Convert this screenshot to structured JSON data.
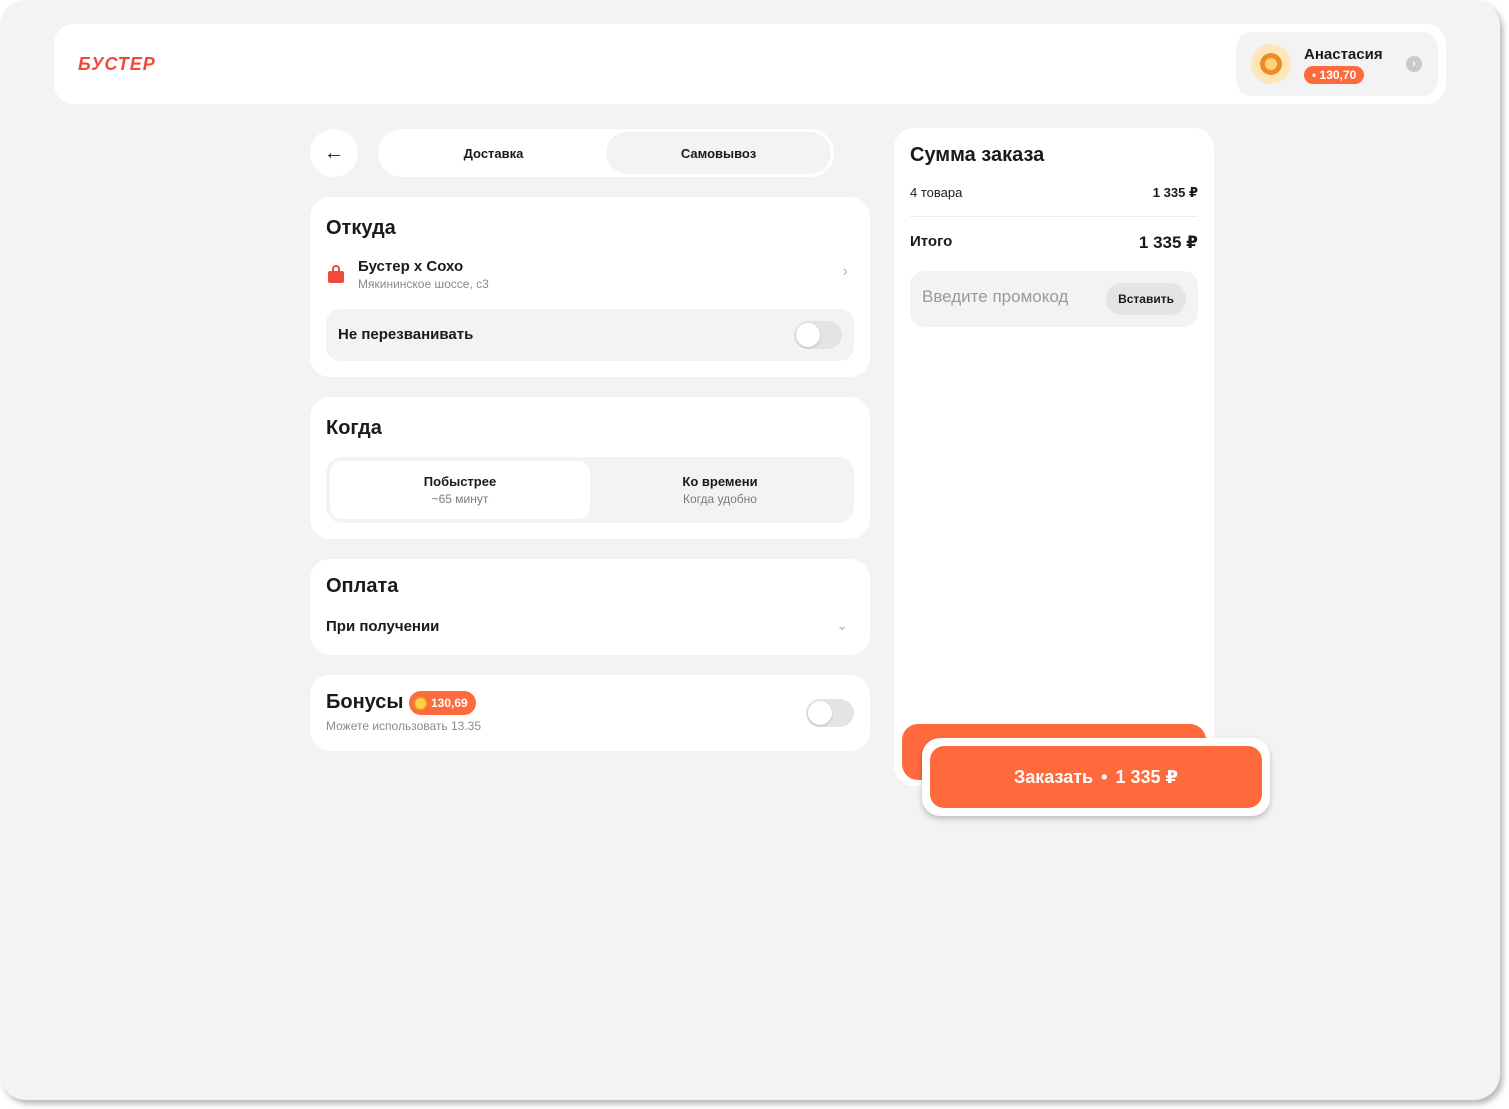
{
  "header": {
    "logo": "БУСТЕР",
    "user": {
      "name": "Анастасия",
      "balance": "• 130,70"
    }
  },
  "delivery_tabs": [
    {
      "label": "Доставка",
      "active": false
    },
    {
      "label": "Самовывоз",
      "active": true
    }
  ],
  "from": {
    "title": "Откуда",
    "store_name": "Бустер х Сохо",
    "store_address": "Мякининское шоссе, с3",
    "no_call_label": "Не перезванивать",
    "no_call_enabled": false
  },
  "when": {
    "title": "Когда",
    "options": [
      {
        "title": "Побыстрее",
        "subtitle": "~65 минут",
        "active": true
      },
      {
        "title": "Ко времени",
        "subtitle": "Когда удобно",
        "active": false
      }
    ]
  },
  "payment": {
    "title": "Оплата",
    "selected": "При получении"
  },
  "bonuses": {
    "title": "Бонусы",
    "badge": "130,69",
    "subtitle": "Можете использовать 13.35",
    "enabled": false
  },
  "summary": {
    "title": "Сумма заказа",
    "items_label": "4 товара",
    "items_value": "1 335 ₽",
    "total_label": "Итого",
    "total_value": "1 335 ₽",
    "promo_placeholder": "Введите промокод",
    "paste_label": "Вставить"
  },
  "order_button": {
    "label": "Заказать",
    "separator": "•",
    "amount": "1 335 ₽"
  },
  "colors": {
    "accent": "#ff6a3d",
    "logo": "#f04a3a",
    "background": "#f3f3f4"
  },
  "icons": [
    "lion-avatar-icon",
    "chevron-right-icon",
    "arrow-left-icon",
    "shopping-bag-icon",
    "chevron-down-icon",
    "coin-icon"
  ]
}
